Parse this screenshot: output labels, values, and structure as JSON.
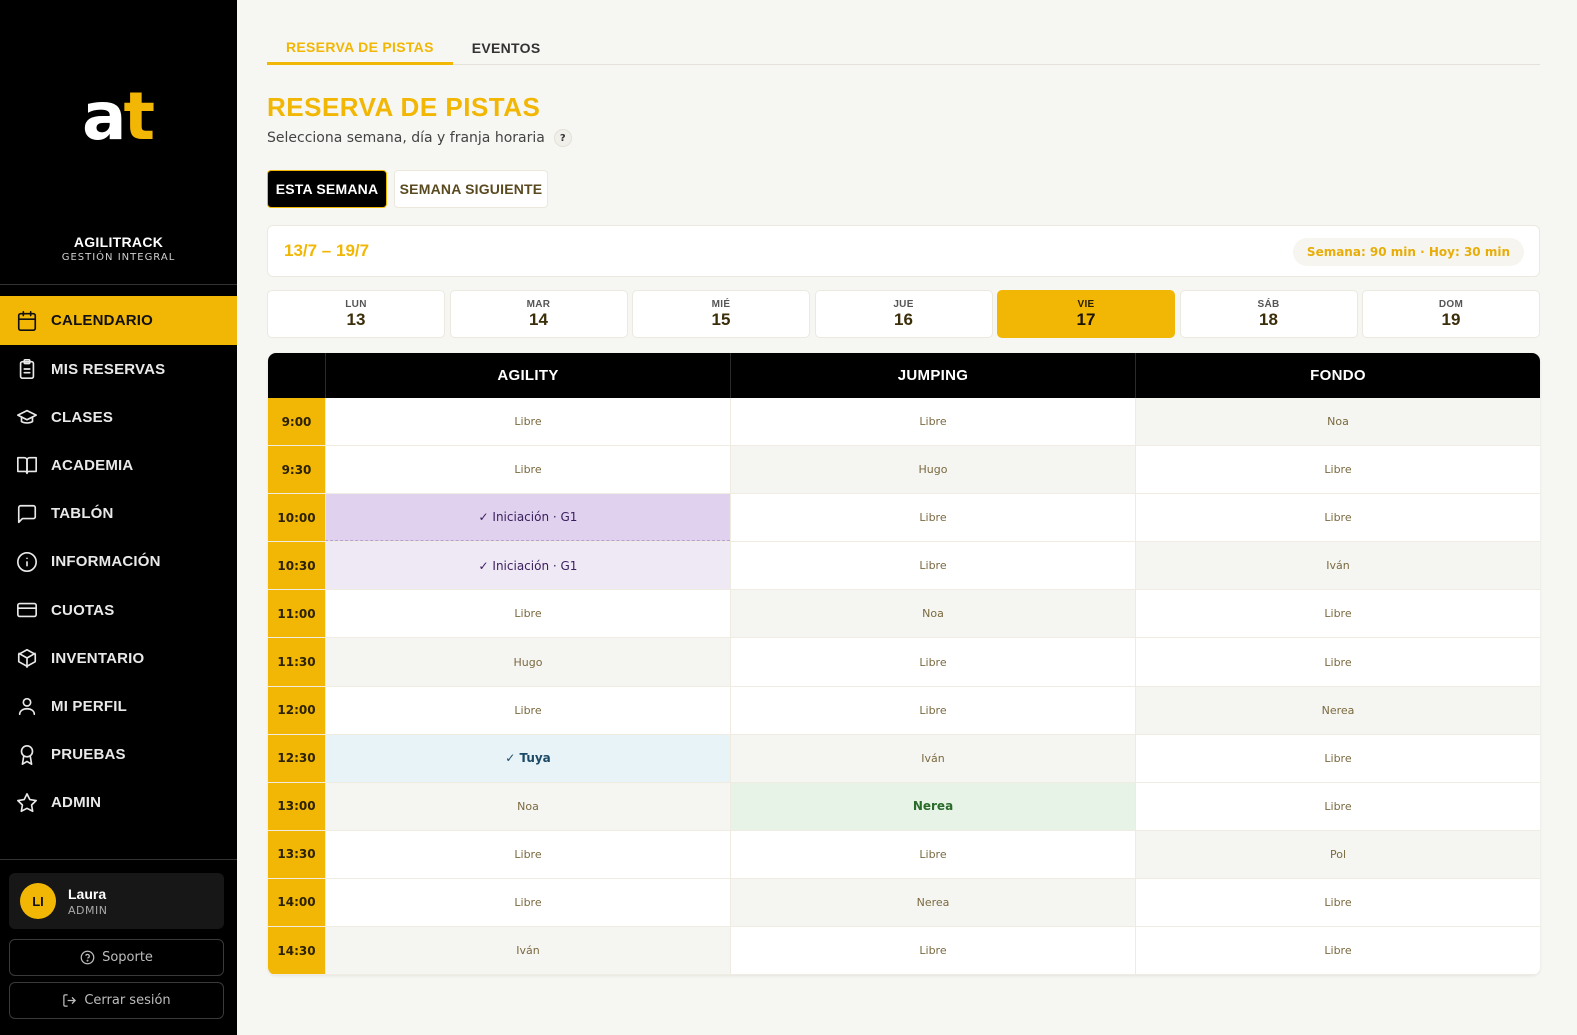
{
  "sidebar": {
    "logo": {
      "a": "a",
      "t": "t"
    },
    "brand_name": "AGILITRACK",
    "brand_sub": "GESTIÓN INTEGRAL",
    "items": [
      {
        "label": "CALENDARIO",
        "icon": "calendar-icon",
        "active": true
      },
      {
        "label": "MIS RESERVAS",
        "icon": "clipboard-icon"
      },
      {
        "label": "CLASES",
        "icon": "graduation-cap-icon"
      },
      {
        "label": "ACADEMIA",
        "icon": "book-open-icon"
      },
      {
        "label": "TABLÓN",
        "icon": "message-square-icon"
      },
      {
        "label": "INFORMACIÓN",
        "icon": "info-icon"
      },
      {
        "label": "CUOTAS",
        "icon": "credit-card-icon"
      },
      {
        "label": "INVENTARIO",
        "icon": "box-icon"
      },
      {
        "label": "MI PERFIL",
        "icon": "user-icon"
      },
      {
        "label": "PRUEBAS",
        "icon": "award-icon"
      },
      {
        "label": "ADMIN",
        "icon": "star-icon"
      }
    ],
    "user": {
      "initials": "LI",
      "name": "Laura",
      "role": "ADMIN"
    },
    "support_label": "Soporte",
    "logout_label": "Cerrar sesión"
  },
  "tabs": [
    {
      "label": "RESERVA DE PISTAS",
      "active": true
    },
    {
      "label": "EVENTOS"
    }
  ],
  "header": {
    "title": "RESERVA DE PISTAS",
    "subtitle": "Selecciona semana, día y franja horaria",
    "help": "?"
  },
  "week_buttons": {
    "current": "ESTA SEMANA",
    "next": "SEMANA SIGUIENTE"
  },
  "range": {
    "text": "13/7 – 19/7",
    "badge": "Semana: 90 min · Hoy: 30 min"
  },
  "days": [
    {
      "name": "LUN",
      "num": "13"
    },
    {
      "name": "MAR",
      "num": "14"
    },
    {
      "name": "MIÉ",
      "num": "15"
    },
    {
      "name": "JUE",
      "num": "16"
    },
    {
      "name": "VIE",
      "num": "17",
      "active": true
    },
    {
      "name": "SÁB",
      "num": "18"
    },
    {
      "name": "DOM",
      "num": "19"
    }
  ],
  "schedule": {
    "columns": [
      "AGILITY",
      "JUMPING",
      "FONDO"
    ],
    "rows": [
      {
        "time": "9:00",
        "cells": [
          [
            "Libre",
            "libre"
          ],
          [
            "Libre",
            "libre"
          ],
          [
            "Noa",
            "taken"
          ]
        ]
      },
      {
        "time": "9:30",
        "cells": [
          [
            "Libre",
            "libre"
          ],
          [
            "Hugo",
            "taken"
          ],
          [
            "Libre",
            "libre"
          ]
        ]
      },
      {
        "time": "10:00",
        "cells": [
          [
            "✓ Iniciación · G1",
            "clase1"
          ],
          [
            "Libre",
            "libre"
          ],
          [
            "Libre",
            "libre"
          ]
        ]
      },
      {
        "time": "10:30",
        "cells": [
          [
            "✓ Iniciación · G1",
            "clase2"
          ],
          [
            "Libre",
            "libre"
          ],
          [
            "Iván",
            "taken"
          ]
        ]
      },
      {
        "time": "11:00",
        "cells": [
          [
            "Libre",
            "libre"
          ],
          [
            "Noa",
            "taken"
          ],
          [
            "Libre",
            "libre"
          ]
        ]
      },
      {
        "time": "11:30",
        "cells": [
          [
            "Hugo",
            "taken"
          ],
          [
            "Libre",
            "libre"
          ],
          [
            "Libre",
            "libre"
          ]
        ]
      },
      {
        "time": "12:00",
        "cells": [
          [
            "Libre",
            "libre"
          ],
          [
            "Libre",
            "libre"
          ],
          [
            "Nerea",
            "taken"
          ]
        ]
      },
      {
        "time": "12:30",
        "cells": [
          [
            "✓ Tuya",
            "mine"
          ],
          [
            "Iván",
            "taken"
          ],
          [
            "Libre",
            "libre"
          ]
        ]
      },
      {
        "time": "13:00",
        "cells": [
          [
            "Noa",
            "taken"
          ],
          [
            "Nerea",
            "fav"
          ],
          [
            "Libre",
            "libre"
          ]
        ]
      },
      {
        "time": "13:30",
        "cells": [
          [
            "Libre",
            "libre"
          ],
          [
            "Libre",
            "libre"
          ],
          [
            "Pol",
            "taken"
          ]
        ]
      },
      {
        "time": "14:00",
        "cells": [
          [
            "Libre",
            "libre"
          ],
          [
            "Nerea",
            "taken"
          ],
          [
            "Libre",
            "libre"
          ]
        ]
      },
      {
        "time": "14:30",
        "cells": [
          [
            "Iván",
            "taken"
          ],
          [
            "Libre",
            "libre"
          ],
          [
            "Libre",
            "libre"
          ]
        ]
      }
    ]
  },
  "colors": {
    "accent": "#f2b705",
    "sidebar": "#000000",
    "background": "#f6f6f3"
  }
}
